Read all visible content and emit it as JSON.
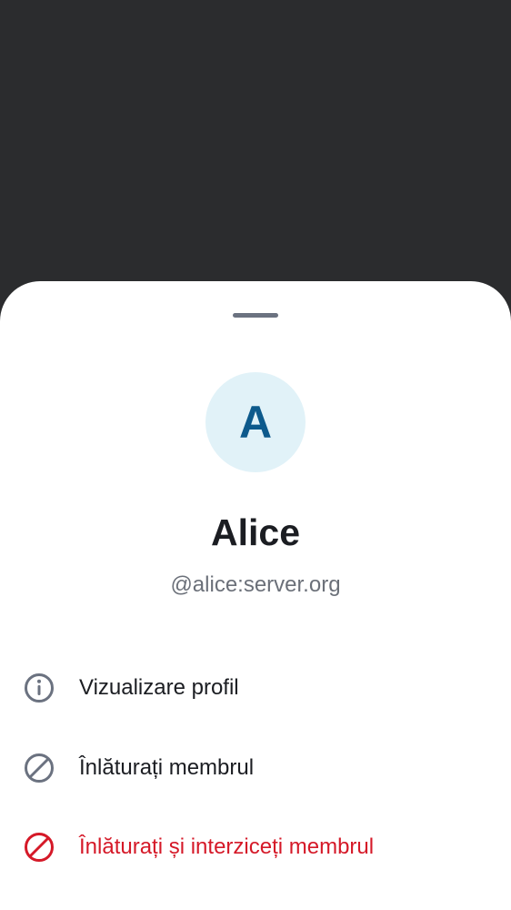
{
  "profile": {
    "avatar_initial": "A",
    "display_name": "Alice",
    "user_id": "@alice:server.org"
  },
  "menu": {
    "items": [
      {
        "label": "Vizualizare profil",
        "icon": "info-icon"
      },
      {
        "label": "Înlăturați membrul",
        "icon": "block-icon"
      },
      {
        "label": "Înlăturați și interziceți membrul",
        "icon": "ban-icon"
      }
    ]
  },
  "colors": {
    "scrim": "#2b2c2e",
    "sheet": "#ffffff",
    "avatar_bg": "#e1f2f8",
    "avatar_fg": "#0d5a8c",
    "icon_gray": "#6b7280",
    "danger": "#d51928"
  }
}
